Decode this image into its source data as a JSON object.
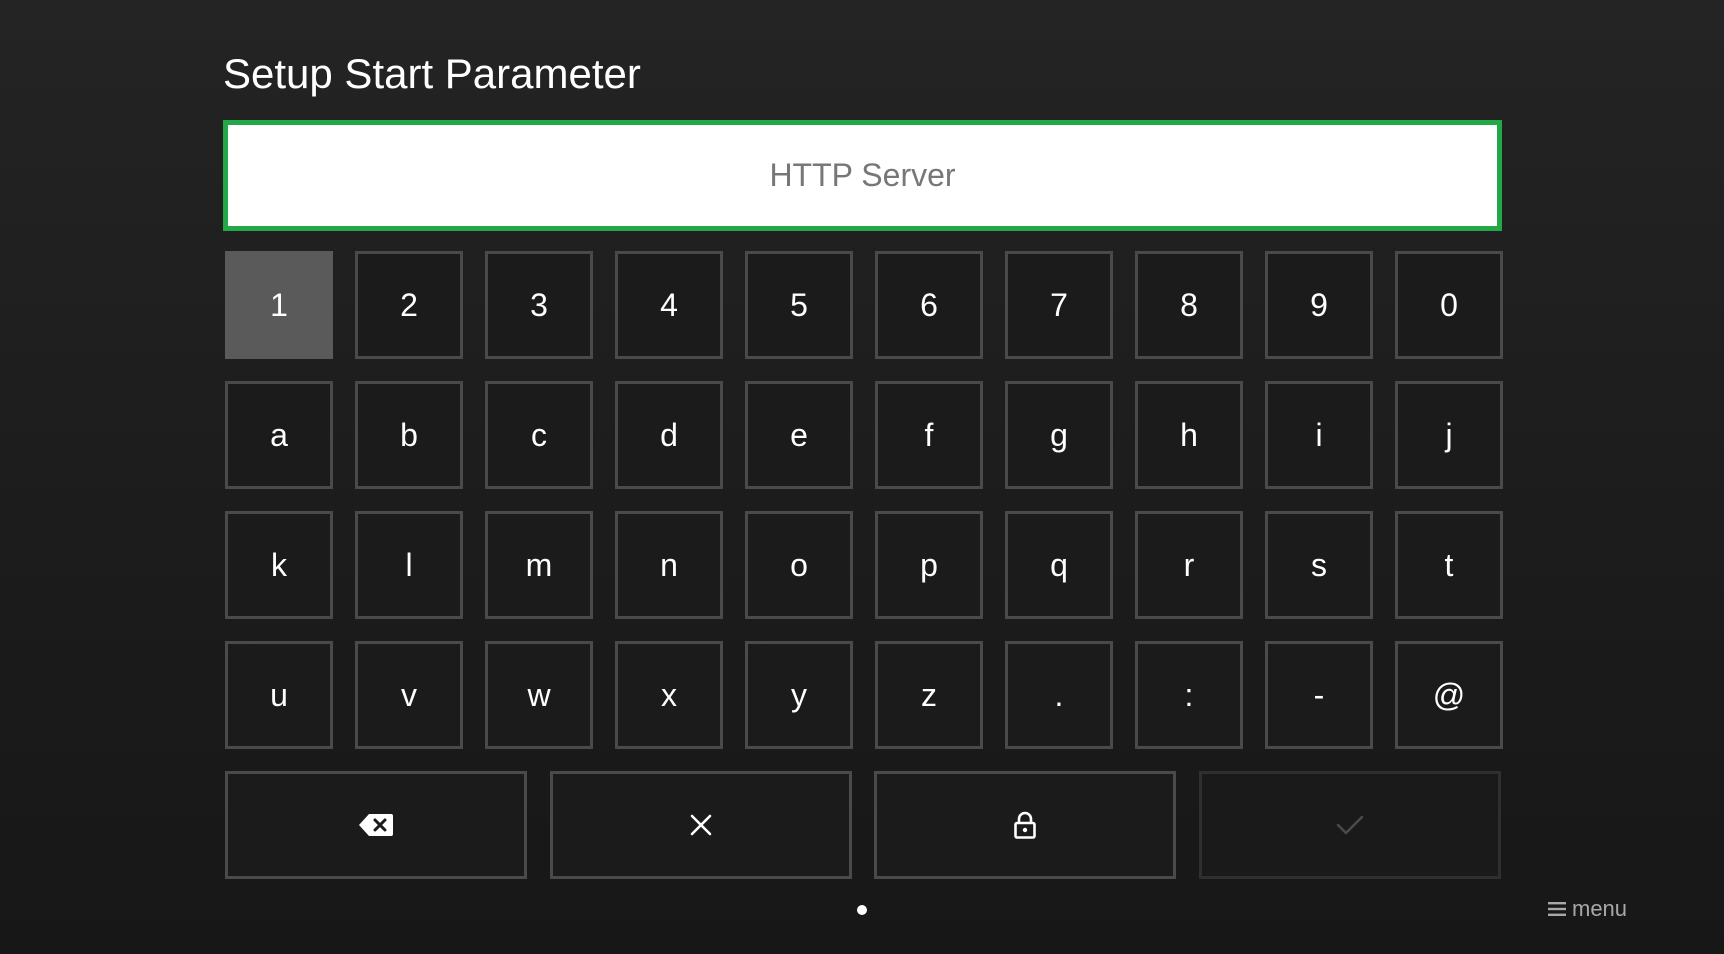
{
  "title": "Setup Start Parameter",
  "input": {
    "placeholder": "HTTP Server",
    "value": ""
  },
  "keyboard": {
    "rows": [
      [
        "1",
        "2",
        "3",
        "4",
        "5",
        "6",
        "7",
        "8",
        "9",
        "0"
      ],
      [
        "a",
        "b",
        "c",
        "d",
        "e",
        "f",
        "g",
        "h",
        "i",
        "j"
      ],
      [
        "k",
        "l",
        "m",
        "n",
        "o",
        "p",
        "q",
        "r",
        "s",
        "t"
      ],
      [
        "u",
        "v",
        "w",
        "x",
        "y",
        "z",
        ".",
        ":",
        "-",
        "@"
      ]
    ],
    "focused_key": "1",
    "actions": [
      {
        "name": "backspace",
        "icon": "backspace-icon",
        "enabled": true
      },
      {
        "name": "clear",
        "icon": "close-icon",
        "enabled": true
      },
      {
        "name": "lock",
        "icon": "lock-icon",
        "enabled": true
      },
      {
        "name": "confirm",
        "icon": "check-icon",
        "enabled": false
      }
    ]
  },
  "pagination": {
    "current": 1,
    "total": 1
  },
  "menu": {
    "label": "menu",
    "icon": "menu-icon"
  },
  "colors": {
    "accent": "#22a847",
    "focused_key": "#5a5a5a",
    "key_border": "#4a4a4a",
    "background": "#1e1e1e"
  }
}
